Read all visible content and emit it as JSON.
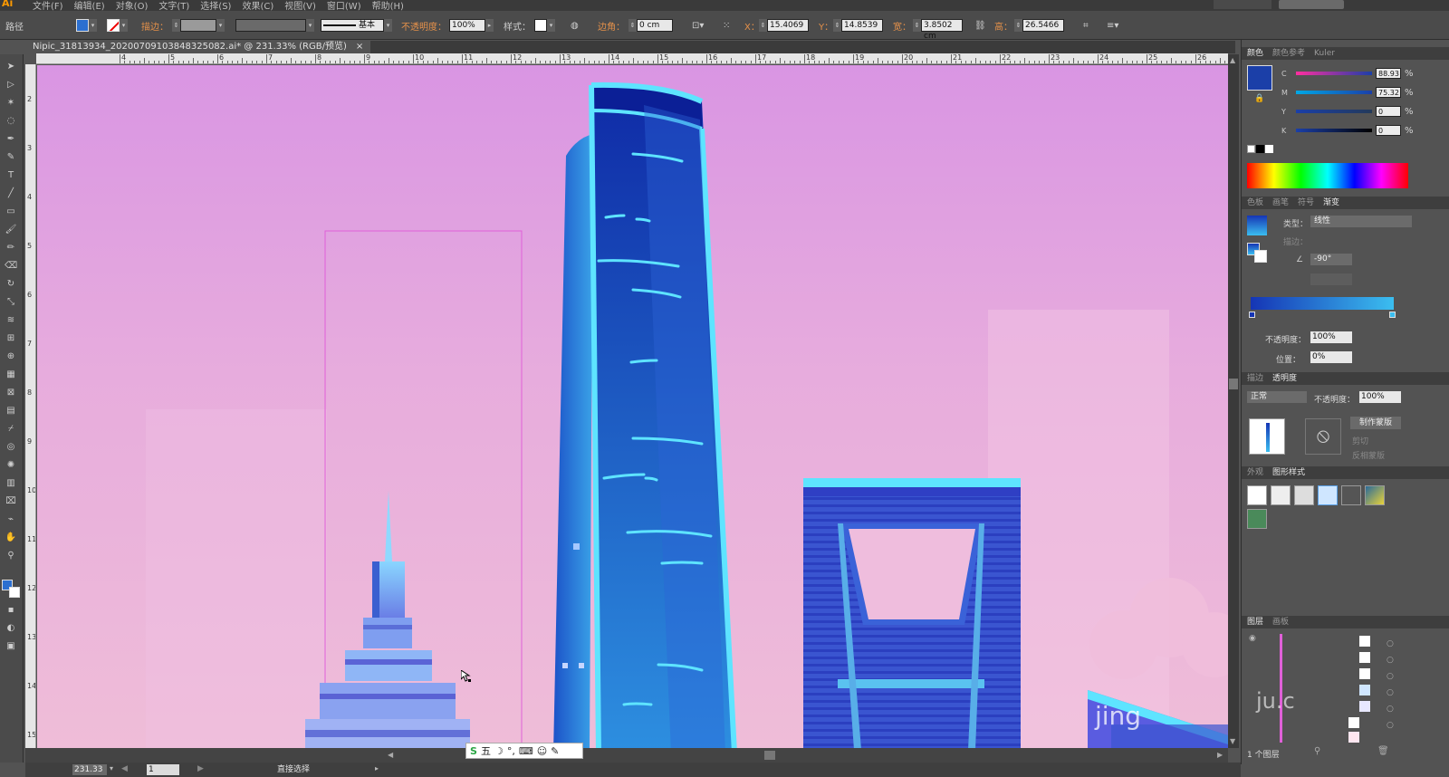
{
  "app": {
    "logo": "Ai",
    "menu": [
      "文件(F)",
      "编辑(E)",
      "对象(O)",
      "文字(T)",
      "选择(S)",
      "效果(C)",
      "视图(V)",
      "窗口(W)",
      "帮助(H)"
    ]
  },
  "control_bar": {
    "mode_label": "路径",
    "stroke_label": "描边：",
    "stroke_profile": "基本",
    "opacity_label": "不透明度：",
    "opacity_value": "100%",
    "style_label": "样式：",
    "corner_label": "边角：",
    "corner_value": "0 cm",
    "x_label": "X：",
    "x_value": "15.4069",
    "y_label": "Y：",
    "y_value": "14.8539",
    "w_label": "宽：",
    "w_value": "3.8502 cm",
    "h_label": "高：",
    "h_value": "26.5466"
  },
  "document_tab": {
    "title": "Nipic_31813934_20200709103848325082.ai* @ 231.33% (RGB/预览)",
    "close": "×"
  },
  "ruler": {
    "top": [
      "4",
      "5",
      "6",
      "7",
      "8",
      "9",
      "10",
      "11",
      "12",
      "13",
      "14",
      "15",
      "16",
      "17",
      "18",
      "19",
      "20",
      "21",
      "22",
      "23",
      "24",
      "25",
      "26"
    ],
    "left": [
      "2",
      "3",
      "4",
      "5",
      "6",
      "7",
      "8",
      "9",
      "10",
      "11",
      "12",
      "13",
      "14",
      "15"
    ]
  },
  "color_panel": {
    "tabs": [
      "颜色",
      "颜色参考",
      "Kuler"
    ],
    "channels": [
      {
        "name": "C",
        "value": "88.93",
        "unit": "%"
      },
      {
        "name": "M",
        "value": "75.32",
        "unit": "%"
      },
      {
        "name": "Y",
        "value": "0",
        "unit": "%"
      },
      {
        "name": "K",
        "value": "0",
        "unit": "%"
      }
    ],
    "current_color": "#1b3fa8"
  },
  "gradient_panel": {
    "tabs": [
      "色板",
      "画笔",
      "符号",
      "渐变"
    ],
    "type_label": "类型：",
    "type_value": "线性",
    "stroke_label": "描边：",
    "angle_value": "-90°",
    "opacity_label": "不透明度：",
    "opacity_value": "100%",
    "position_label": "位置：",
    "position_value": "0%",
    "start_color": "#1535b5",
    "end_color": "#3bbef0"
  },
  "transparency_panel": {
    "tabs": [
      "描边",
      "透明度"
    ],
    "blend_mode": "正常",
    "opacity_label": "不透明度：",
    "opacity_value": "100%",
    "make_mask": "制作蒙版",
    "clip": "剪切",
    "invert_mask": "反相蒙版"
  },
  "graphic_styles_panel": {
    "tabs": [
      "外观",
      "图形样式"
    ]
  },
  "layers_panel": {
    "tabs": [
      "图层",
      "画板"
    ],
    "footer_count": "1 个图层"
  },
  "status_bar": {
    "zoom": "231.33",
    "artboard_num": "1",
    "tool_status": "直接选择"
  },
  "ime_bar": {
    "mode": "五"
  },
  "artwork": {
    "watermark": "jing",
    "partial_overlay": "ju.c",
    "colors": {
      "sky_top": "#d995e3",
      "sky_bottom": "#efbdd8",
      "tower_dark": "#1637b0",
      "tower_light": "#3ab8ee",
      "accent_cyan": "#59e0ff",
      "selection": "#e060d8"
    }
  }
}
